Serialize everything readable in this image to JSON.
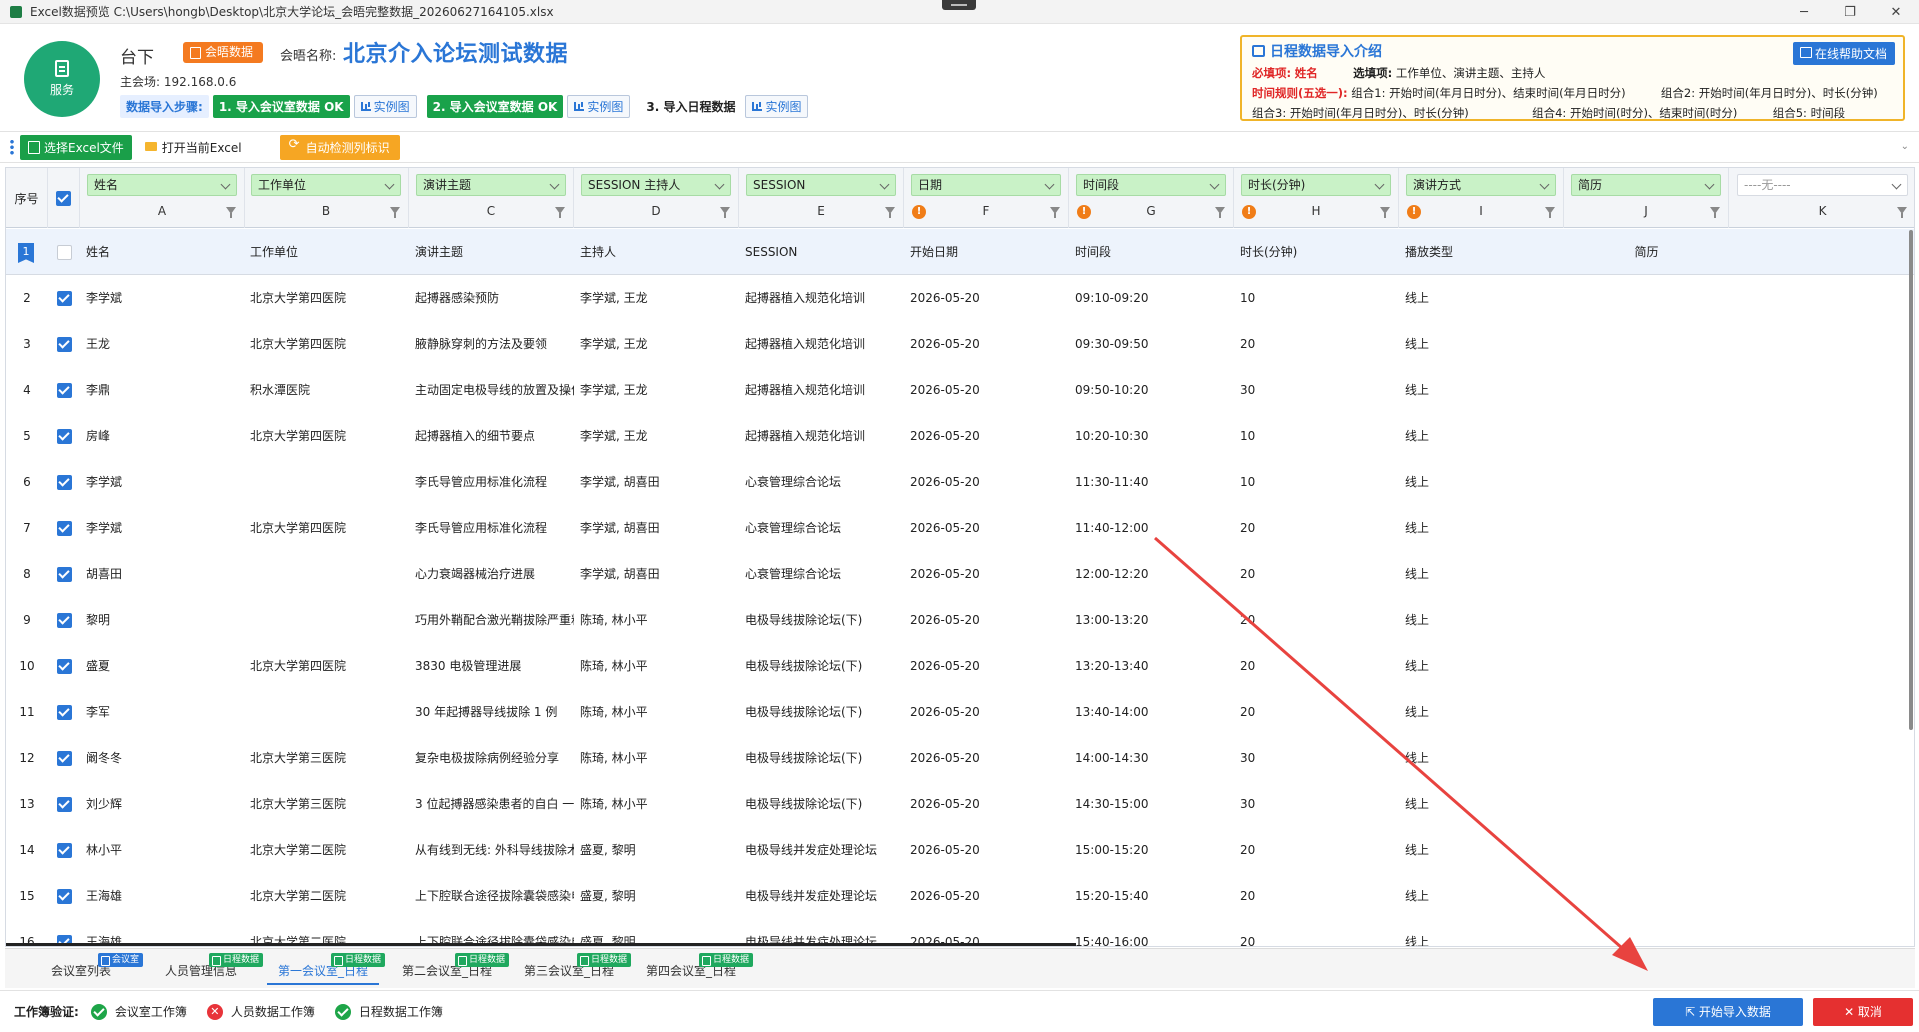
{
  "window": {
    "title": "Excel数据预览 C:\\Users\\hongb\\Desktop\\北京大学论坛_会晤完整数据_20260627164105.xlsx",
    "min_glyph": "─",
    "max_glyph": "❐",
    "close_glyph": "✕"
  },
  "header": {
    "logo_label": "服务",
    "venue": "台下",
    "meeting_tag": "会晤数据",
    "meeting_label": "会晤名称:",
    "meeting_name": "北京介入论坛测试数据",
    "host": "主会场: 192.168.0.6",
    "steps_label": "数据导入步骤:",
    "step1": "1. 导入会议室数据 OK",
    "step2": "2. 导入会议室数据 OK",
    "step3": "3. 导入日程数据",
    "example": "实例图"
  },
  "intro": {
    "title": "日程数据导入介绍",
    "help": "在线帮助文档",
    "required_label": "必填项:",
    "required_value": "姓名",
    "optional_label": "选填项:",
    "optional_value": "工作单位、演讲主题、主持人",
    "rule_label": "时间规则(五选一):",
    "combo1": "组合1:  开始时间(年月日时分)、结束时间(年月日时分)",
    "combo2": "组合2:  开始时间(年月日时分)、时长(分钟)",
    "combo3": "组合3:  开始时间(年月日时分)、时长(分钟)",
    "combo4": "组合4:  开始时间(时分)、结束时间(时分)",
    "combo5": "组合5:  时间段"
  },
  "toolbar": {
    "select_file": "选择Excel文件",
    "open_excel": "打开当前Excel",
    "auto_detect": "自动检测列标识"
  },
  "grid": {
    "seq_header": "序号",
    "columns": [
      {
        "select": "姓名",
        "letter": "A",
        "warn": false
      },
      {
        "select": "工作单位",
        "letter": "B",
        "warn": false
      },
      {
        "select": "演讲主题",
        "letter": "C",
        "warn": false
      },
      {
        "select": "SESSION 主持人",
        "letter": "D",
        "warn": false
      },
      {
        "select": "SESSION",
        "letter": "E",
        "warn": false
      },
      {
        "select": "日期",
        "letter": "F",
        "warn": true
      },
      {
        "select": "时间段",
        "letter": "G",
        "warn": true
      },
      {
        "select": "时长(分钟)",
        "letter": "H",
        "warn": true
      },
      {
        "select": "演讲方式",
        "letter": "I",
        "warn": true
      },
      {
        "select": "简历",
        "letter": "J",
        "warn": false
      },
      {
        "select": "----无----",
        "letter": "K",
        "warn": false
      }
    ],
    "warn_glyph": "!",
    "header_row": {
      "seq": "1",
      "cells": [
        "姓名",
        "工作单位",
        "演讲主题",
        "主持人",
        "SESSION",
        "开始日期",
        "时间段",
        "时长(分钟)",
        "播放类型",
        "简历",
        ""
      ]
    },
    "rows": [
      {
        "seq": "2",
        "cells": [
          "李学斌",
          "北京大学第四医院",
          "起搏器感染预防",
          "李学斌, 王龙",
          "起搏器植入规范化培训",
          "2026-05-20",
          "09:10-09:20",
          "10",
          "线上",
          "",
          ""
        ]
      },
      {
        "seq": "3",
        "cells": [
          "王龙",
          "北京大学第四医院",
          "腋静脉穿刺的方法及要领",
          "李学斌, 王龙",
          "起搏器植入规范化培训",
          "2026-05-20",
          "09:30-09:50",
          "20",
          "线上",
          "",
          ""
        ]
      },
      {
        "seq": "4",
        "cells": [
          "李鼎",
          "积水潭医院",
          "主动固定电极导线的放置及操作",
          "李学斌, 王龙",
          "起搏器植入规范化培训",
          "2026-05-20",
          "09:50-10:20",
          "30",
          "线上",
          "",
          ""
        ]
      },
      {
        "seq": "5",
        "cells": [
          "房峰",
          "北京大学第四医院",
          "起搏器植入的细节要点",
          "李学斌, 王龙",
          "起搏器植入规范化培训",
          "2026-05-20",
          "10:20-10:30",
          "10",
          "线上",
          "",
          ""
        ]
      },
      {
        "seq": "6",
        "cells": [
          "李学斌",
          "",
          "李氏导管应用标准化流程",
          "李学斌, 胡喜田",
          "心衰管理综合论坛",
          "2026-05-20",
          "11:30-11:40",
          "10",
          "线上",
          "",
          ""
        ]
      },
      {
        "seq": "7",
        "cells": [
          "李学斌",
          "北京大学第四医院",
          "李氏导管应用标准化流程",
          "李学斌, 胡喜田",
          "心衰管理综合论坛",
          "2026-05-20",
          "11:40-12:00",
          "20",
          "线上",
          "",
          ""
        ]
      },
      {
        "seq": "8",
        "cells": [
          "胡喜田",
          "",
          "心力衰竭器械治疗进展",
          "李学斌, 胡喜田",
          "心衰管理综合论坛",
          "2026-05-20",
          "12:00-12:20",
          "20",
          "线上",
          "",
          ""
        ]
      },
      {
        "seq": "9",
        "cells": [
          "黎明",
          "",
          "巧用外鞘配合激光鞘拔除严重粘连",
          "陈琦, 林小平",
          "电极导线拔除论坛(下)",
          "2026-05-20",
          "13:00-13:20",
          "20",
          "线上",
          "",
          ""
        ]
      },
      {
        "seq": "10",
        "cells": [
          "盛夏",
          "北京大学第四医院",
          "3830 电极管理进展",
          "陈琦, 林小平",
          "电极导线拔除论坛(下)",
          "2026-05-20",
          "13:20-13:40",
          "20",
          "线上",
          "",
          ""
        ]
      },
      {
        "seq": "11",
        "cells": [
          "李军",
          "",
          "30 年起搏器导线拔除 1 例",
          "陈琦, 林小平",
          "电极导线拔除论坛(下)",
          "2026-05-20",
          "13:40-14:00",
          "20",
          "线上",
          "",
          ""
        ]
      },
      {
        "seq": "12",
        "cells": [
          "阚冬冬",
          "北京大学第三医院",
          "复杂电极拔除病例经验分享",
          "陈琦, 林小平",
          "电极导线拔除论坛(下)",
          "2026-05-20",
          "14:00-14:30",
          "30",
          "线上",
          "",
          ""
        ]
      },
      {
        "seq": "13",
        "cells": [
          "刘少辉",
          "北京大学第三医院",
          "3 位起搏器感染患者的自白 一",
          "陈琦, 林小平",
          "电极导线拔除论坛(下)",
          "2026-05-20",
          "14:30-15:00",
          "30",
          "线上",
          "",
          ""
        ]
      },
      {
        "seq": "14",
        "cells": [
          "林小平",
          "北京大学第二医院",
          "从有线到无线: 外科导线拔除术",
          "盛夏, 黎明",
          "电极导线并发症处理论坛",
          "2026-05-20",
          "15:00-15:20",
          "20",
          "线上",
          "",
          ""
        ]
      },
      {
        "seq": "15",
        "cells": [
          "王海雄",
          "北京大学第二医院",
          "上下腔联合途径拔除囊袋感染电极",
          "盛夏, 黎明",
          "电极导线并发症处理论坛",
          "2026-05-20",
          "15:20-15:40",
          "20",
          "线上",
          "",
          ""
        ]
      },
      {
        "seq": "16",
        "cells": [
          "王海雄",
          "北京大学第二医院",
          "上下腔联合途径拔除囊袋感染电极",
          "盛夏, 黎明",
          "电极导线并发症处理论坛",
          "2026-05-20",
          "15:40-16:00",
          "20",
          "线上",
          "",
          ""
        ]
      }
    ]
  },
  "tabs": [
    {
      "label": "会议室列表",
      "badge": "会议室",
      "badge_color": "blue"
    },
    {
      "label": "人员管理信息",
      "badge": "日程数据",
      "badge_color": "green"
    },
    {
      "label": "第一会议室_日程",
      "badge": "日程数据",
      "badge_color": "green"
    },
    {
      "label": "第二会议室_日程",
      "badge": "日程数据",
      "badge_color": "green"
    },
    {
      "label": "第三会议室_日程",
      "badge": "日程数据",
      "badge_color": "green"
    },
    {
      "label": "第四会议室_日程",
      "badge": "日程数据",
      "badge_color": "green"
    }
  ],
  "status": {
    "label": "工作簿验证:",
    "items": [
      {
        "text": "会议室工作簿",
        "ok": true
      },
      {
        "text": "人员数据工作簿",
        "ok": false
      },
      {
        "text": "日程数据工作簿",
        "ok": true
      }
    ],
    "err_glyph": "✕",
    "import_btn": "⇱ 开始导入数据",
    "cancel_btn": "✕ 取消"
  },
  "colors": {
    "accent": "#2a76d6",
    "ok": "#1ea548",
    "error": "#e53030",
    "annotation_arrow": "#e8433f"
  }
}
